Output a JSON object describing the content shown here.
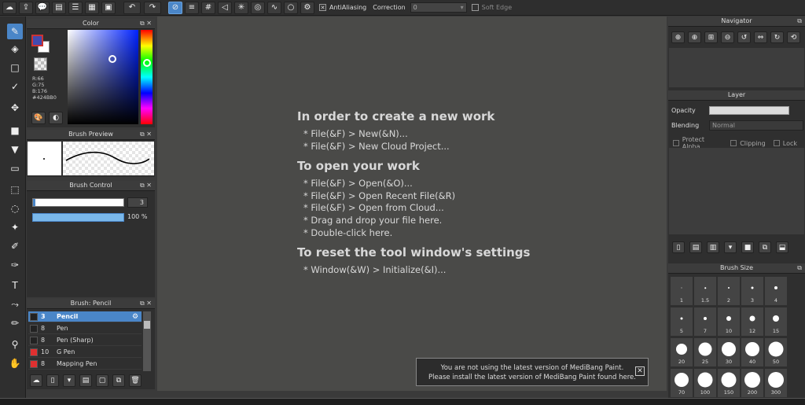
{
  "toolbar": {
    "antialiasing_label": "AntiAliasing",
    "correction_label": "Correction",
    "correction_value": "0",
    "softedge_label": "Soft Edge"
  },
  "color_panel": {
    "title": "Color",
    "r": "R:66",
    "g": "G:75",
    "b": "B:176",
    "hex": "#424BB0",
    "current_color": "#424BB0"
  },
  "brush_preview": {
    "title": "Brush Preview"
  },
  "brush_control": {
    "title": "Brush Control",
    "size_value": "3",
    "opacity_value": "100 %",
    "opacity_fraction": 1.0
  },
  "brush_list": {
    "title": "Brush: Pencil",
    "items": [
      {
        "size": "3",
        "name": "Pencil",
        "color": "#222222"
      },
      {
        "size": "8",
        "name": "Pen",
        "color": "#222222"
      },
      {
        "size": "8",
        "name": "Pen (Sharp)",
        "color": "#222222"
      },
      {
        "size": "10",
        "name": "G Pen",
        "color": "#e03030"
      },
      {
        "size": "8",
        "name": "Mapping Pen",
        "color": "#e03030"
      }
    ]
  },
  "welcome": {
    "new_title": "In order to create a new work",
    "new_lines": [
      "* File(&F) > New(&N)...",
      "* File(&F) > New Cloud Project..."
    ],
    "open_title": "To open your work",
    "open_lines": [
      "* File(&F) > Open(&O)...",
      "* File(&F) > Open Recent File(&R)",
      "* File(&F) > Open from Cloud...",
      "* Drag and drop your file here.",
      "* Double-click here."
    ],
    "reset_title": "To reset the tool window's settings",
    "reset_lines": [
      "* Window(&W) > Initialize(&I)..."
    ]
  },
  "notice": {
    "line1": "You are not using the latest version of MediBang Paint.",
    "line2": "Please install the latest version of MediBang Paint found here."
  },
  "navigator": {
    "title": "Navigator"
  },
  "layer": {
    "title": "Layer",
    "opacity_label": "Opacity",
    "blending_label": "Blending",
    "blending_value": "Normal",
    "protect_alpha": "Protect Alpha",
    "clipping": "Clipping",
    "lock": "Lock"
  },
  "brush_size": {
    "title": "Brush Size",
    "sizes": [
      "1",
      "1.5",
      "2",
      "3",
      "4",
      "5",
      "7",
      "10",
      "12",
      "15",
      "20",
      "25",
      "30",
      "40",
      "50",
      "70",
      "100",
      "150",
      "200",
      "300"
    ]
  }
}
